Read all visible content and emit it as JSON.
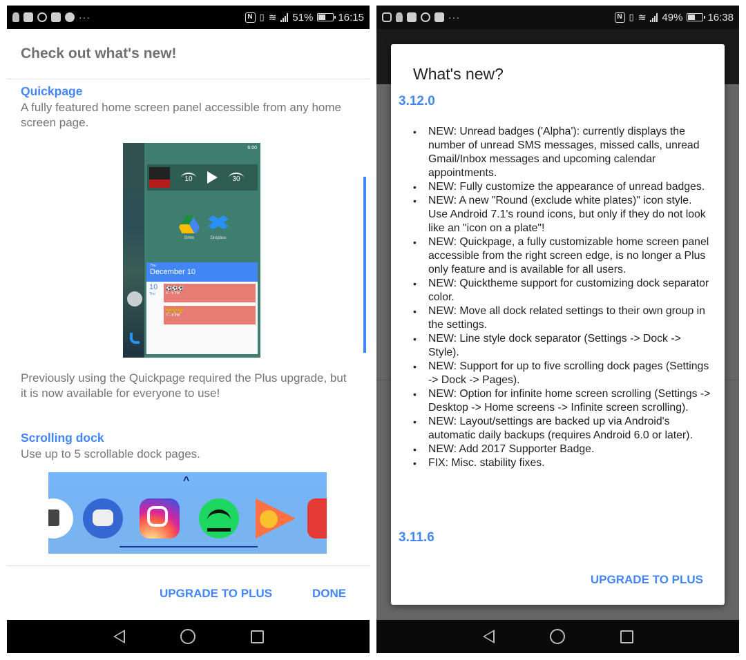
{
  "left": {
    "status": {
      "notif_icons": [
        "person-icon",
        "briefcase-icon",
        "whatsapp-icon",
        "youtube-icon",
        "messenger-icon"
      ],
      "more": "···",
      "battery_pct_text": "51%",
      "battery_level": 0.51,
      "time": "16:15"
    },
    "title": "Check out what's new!",
    "features": [
      {
        "title": "Quickpage",
        "desc": "A fully featured home screen panel accessible from any home screen page.",
        "note": "Previously using the Quickpage required the Plus upgrade, but it is now available for everyone to use!"
      },
      {
        "title": "Scrolling dock",
        "desc": "Use up to 5 scrollable dock pages."
      }
    ],
    "quickpage_preview": {
      "time": "6:00",
      "rewind": "10",
      "forward": "30",
      "apps": [
        "Drive",
        "Dropbox"
      ],
      "cal_dow": "Thu",
      "cal_date": "December 10",
      "day_num": "10",
      "day_dow": "Thu",
      "events": [
        {
          "title": "⚽⚽⚽",
          "time": "4 – 5 PM"
        },
        {
          "title": "🍔🍔🍔",
          "time": "7 – 8 PM"
        }
      ]
    },
    "dock_preview": {
      "apps": [
        "Camera",
        "Messages",
        "Instagram",
        "Spotify",
        "Play Music",
        "YouTube"
      ]
    },
    "scroll_position": 0.35,
    "buttons": {
      "upgrade": "UPGRADE TO PLUS",
      "done": "DONE"
    }
  },
  "right": {
    "status": {
      "notif_icons": [
        "instagram-icon",
        "person-icon",
        "briefcase-icon",
        "whatsapp-icon",
        "youtube-icon"
      ],
      "more": "···",
      "battery_pct_text": "49%",
      "battery_level": 0.49,
      "time": "16:38"
    },
    "dialog": {
      "title": "What's new?",
      "versions": [
        {
          "version": "3.12.0",
          "items": [
            "NEW: Unread badges ('Alpha'): currently displays the number of unread SMS messages, missed calls, unread Gmail/Inbox messages and upcoming calendar appointments.",
            "NEW: Fully customize the appearance of unread badges.",
            "NEW: A new \"Round (exclude white plates)\" icon style. Use Android 7.1's round icons, but only if they do not look like an \"icon on a plate\"!",
            "NEW: Quickpage, a fully customizable home screen panel accessible from the right screen edge, is no longer a Plus only feature and is available for all users.",
            "NEW: Quicktheme support for customizing dock separator color.",
            "NEW: Move all dock related settings to their own group in the settings.",
            "NEW: Line style dock separator (Settings -> Dock -> Style).",
            "NEW: Support for up to five scrolling dock pages (Settings -> Dock -> Pages).",
            "NEW: Option for infinite home screen scrolling (Settings -> Desktop -> Home screens -> Infinite screen scrolling).",
            "NEW: Layout/settings are backed up via Android's automatic daily backups (requires Android 6.0 or later).",
            "NEW: Add 2017 Supporter Badge.",
            "FIX: Misc. stability fixes."
          ]
        },
        {
          "version": "3.11.6",
          "items": []
        }
      ],
      "button": "UPGRADE TO PLUS"
    }
  },
  "colors": {
    "accent": "#4285f4",
    "title_gray": "#707070",
    "body_gray": "#757575",
    "dim_overlay": "#666666",
    "toolbar": "#1a1a1a"
  }
}
